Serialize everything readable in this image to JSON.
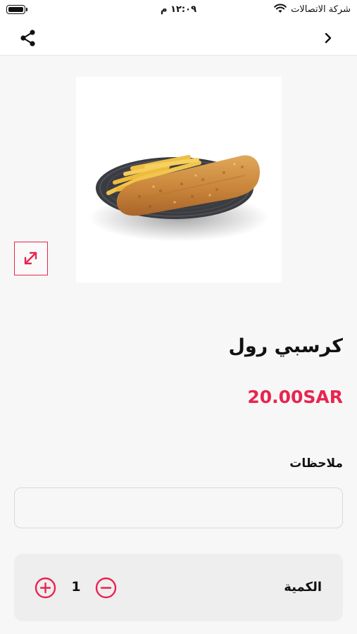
{
  "status_bar": {
    "time": "١٢:٠٩ م",
    "carrier": "شركة الاتصالات",
    "battery_level": 1.0
  },
  "nav": {
    "share_icon": "share-icon",
    "back_icon": "chevron-right-icon"
  },
  "product": {
    "image_alt": "food-plate-image",
    "expand_icon": "expand-icon",
    "name": "كرسبي رول",
    "price": "20.00SAR"
  },
  "notes": {
    "label": "ملاحظات",
    "value": "",
    "placeholder": ""
  },
  "quantity": {
    "label": "الكمية",
    "value": "1",
    "plus_icon": "plus-circle-icon",
    "minus_icon": "minus-circle-icon"
  },
  "colors": {
    "accent": "#e8254f",
    "background": "#f7f7f7",
    "card": "#eeeeee"
  }
}
